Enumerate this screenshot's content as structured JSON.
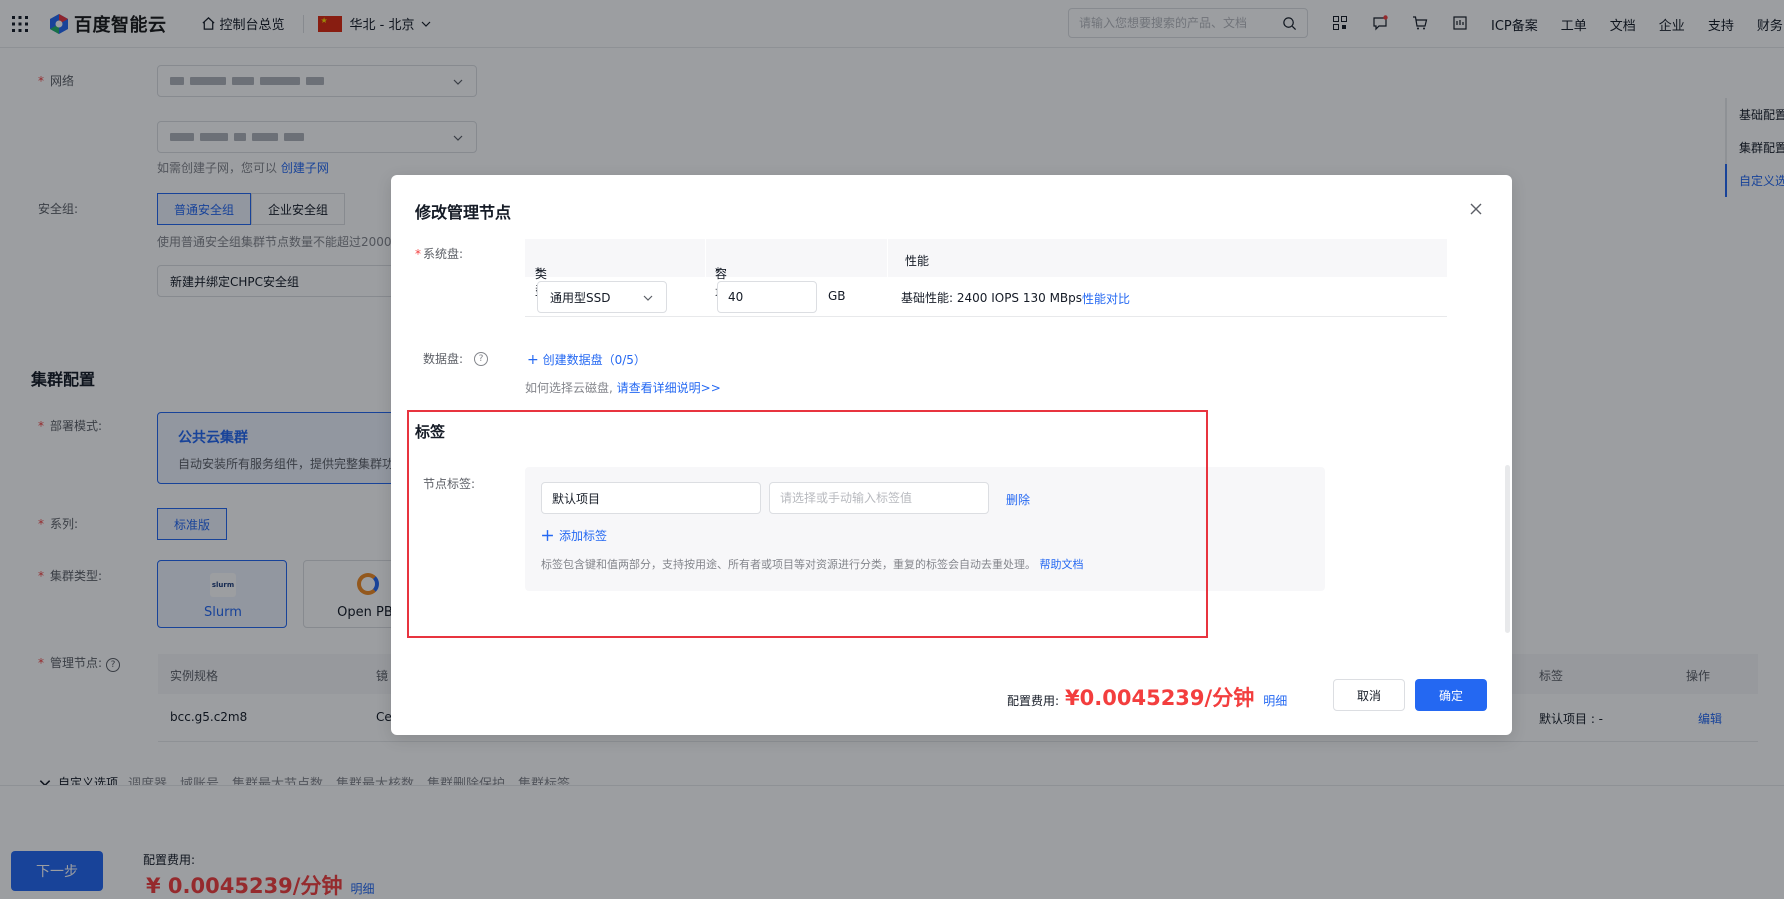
{
  "topbar": {
    "brand": "百度智能云",
    "console_label": "控制台总览",
    "region_label": "华北 - 北京",
    "search_placeholder": "请输入您想要搜索的产品、文档",
    "links": [
      "ICP备案",
      "工单",
      "文档",
      "企业",
      "支持",
      "财务"
    ]
  },
  "anchor_nav": [
    "基础配置",
    "集群配置",
    "自定义选项"
  ],
  "bg_page": {
    "network_label": "网络",
    "subnet_hint": "如需创建子网，您可以",
    "subnet_link": "创建子网",
    "security_group_label": "安全组:",
    "sg_tabs": [
      "普通安全组",
      "企业安全组"
    ],
    "sg_hint": "使用普通安全组集群节点数量不能超过2000",
    "sg_select": "新建并绑定CHPC安全组",
    "cluster_config_title": "集群配置",
    "deploy_mode_label": "部署模式:",
    "deploy_card_title": "公共云集群",
    "deploy_card_desc": "自动安装所有服务组件，提供完整集群功",
    "series_label": "系列:",
    "series_value": "标准版",
    "cluster_type_label": "集群类型:",
    "cluster_types": [
      "Slurm",
      "Open PBS"
    ],
    "slurm_logo_text": "slurm",
    "manager_label": "管理节点:",
    "manager_help": "?",
    "table_headers": [
      "实例规格",
      "镜",
      "标签",
      "操作"
    ],
    "table_row": {
      "spec": "bcc.g5.c2m8",
      "image": "Ce",
      "tag": "默认项目 : -",
      "action": "编辑"
    },
    "custom_toggle": "自定义选项",
    "custom_desc": "调度器、域账号、集群最大节点数、集群最大核数、集群删除保护、集群标签",
    "next_button": "下一步",
    "fee_label": "配置费用:",
    "fee_value": "¥ 0.0045239/分钟",
    "fee_detail": "明细"
  },
  "modal": {
    "title": "修改管理节点",
    "system_disk_label": "系统盘:",
    "disk_headers": {
      "type": "类型",
      "capacity": "容量",
      "perf": "性能"
    },
    "disk_type": "通用型SSD",
    "disk_capacity": "40",
    "disk_unit": "GB",
    "disk_perf": "基础性能:  2400 IOPS 130 MBps",
    "perf_compare": "性能对比",
    "data_disk_label": "数据盘:",
    "data_disk_help": "?",
    "create_data_disk": "创建数据盘（0/5）",
    "disk_hint": "如何选择云磁盘,",
    "disk_hint_link": "请查看详细说明>>",
    "tags_title": "标签",
    "node_tag_label": "节点标签:",
    "tag_key": "默认项目",
    "tag_value_placeholder": "请选择或手动输入标签值",
    "delete": "删除",
    "add_tag": "添加标签",
    "tag_hint": "标签包含键和值两部分，支持按用途、所有者或项目等对资源进行分类，重复的标签会自动去重处理。",
    "help_doc": "帮助文档",
    "fee_label": "配置费用:",
    "fee_value": "¥0.0045239/分钟",
    "fee_detail": "明细",
    "cancel": "取消",
    "confirm": "确定"
  },
  "colors": {
    "primary": "#2468f2",
    "price": "#f33e3e",
    "highlight": "#e8343f"
  }
}
